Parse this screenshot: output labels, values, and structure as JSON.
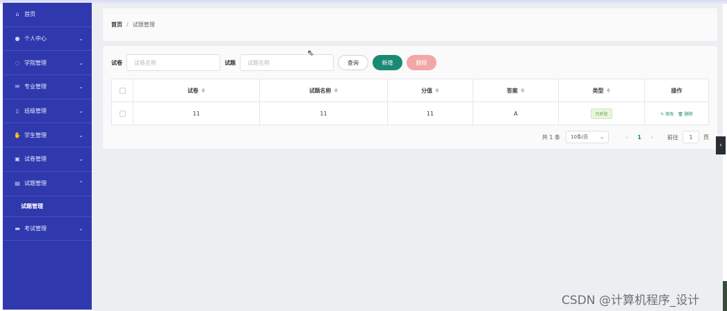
{
  "sidebar": {
    "items": [
      {
        "label": "首页",
        "icon": "home-icon",
        "glyph": "⌂",
        "chevron": ""
      },
      {
        "label": "个人中心",
        "icon": "user-icon",
        "glyph": "●",
        "chevron": "⌄"
      },
      {
        "label": "学院管理",
        "icon": "power-icon",
        "glyph": "◌",
        "chevron": "⌄"
      },
      {
        "label": "专业管理",
        "icon": "mail-icon",
        "glyph": "✉",
        "chevron": "⌄"
      },
      {
        "label": "班级管理",
        "icon": "phone-icon",
        "glyph": "▯",
        "chevron": "⌄"
      },
      {
        "label": "学生管理",
        "icon": "thumb-icon",
        "glyph": "✋",
        "chevron": "⌄"
      },
      {
        "label": "试卷管理",
        "icon": "clipboard-icon",
        "glyph": "▣",
        "chevron": "⌄"
      },
      {
        "label": "试题管理",
        "icon": "doc-icon",
        "glyph": "▤",
        "chevron": "⌃"
      }
    ],
    "submenu_label": "试题管理",
    "last_item": {
      "label": "考试管理",
      "icon": "briefcase-icon",
      "glyph": "▬",
      "chevron": "⌄"
    }
  },
  "breadcrumb": {
    "home": "首页",
    "sep": "/",
    "current": "试题管理"
  },
  "search": {
    "paper_label": "试卷",
    "paper_placeholder": "试卷名称",
    "question_label": "试题",
    "question_placeholder": "试题名称",
    "query_button": "查询",
    "add_button": "新增",
    "delete_button": "删除"
  },
  "table": {
    "columns": [
      "试卷",
      "试题名称",
      "分值",
      "答案",
      "类型",
      "操作"
    ],
    "sort_glyph": "≑",
    "rows": [
      {
        "paper": "11",
        "name": "11",
        "score": "11",
        "answer": "A",
        "type": "判断题",
        "edit": "✎ 修改",
        "delete": "🗑 删除"
      }
    ]
  },
  "pagination": {
    "total": "共 1 条",
    "page_size": "10条/页",
    "prev": "‹",
    "current": "1",
    "next": "›",
    "goto_label": "前往",
    "goto_value": "1",
    "page_suffix": "页"
  },
  "watermark": "CSDN @计算机程序_设计",
  "side_tab_glyph": "‹",
  "cursor_glyph": "⇖",
  "colors": {
    "sidebar": "#2f39ad",
    "accent": "#1a8a73",
    "danger_light": "#f3a6a6"
  }
}
